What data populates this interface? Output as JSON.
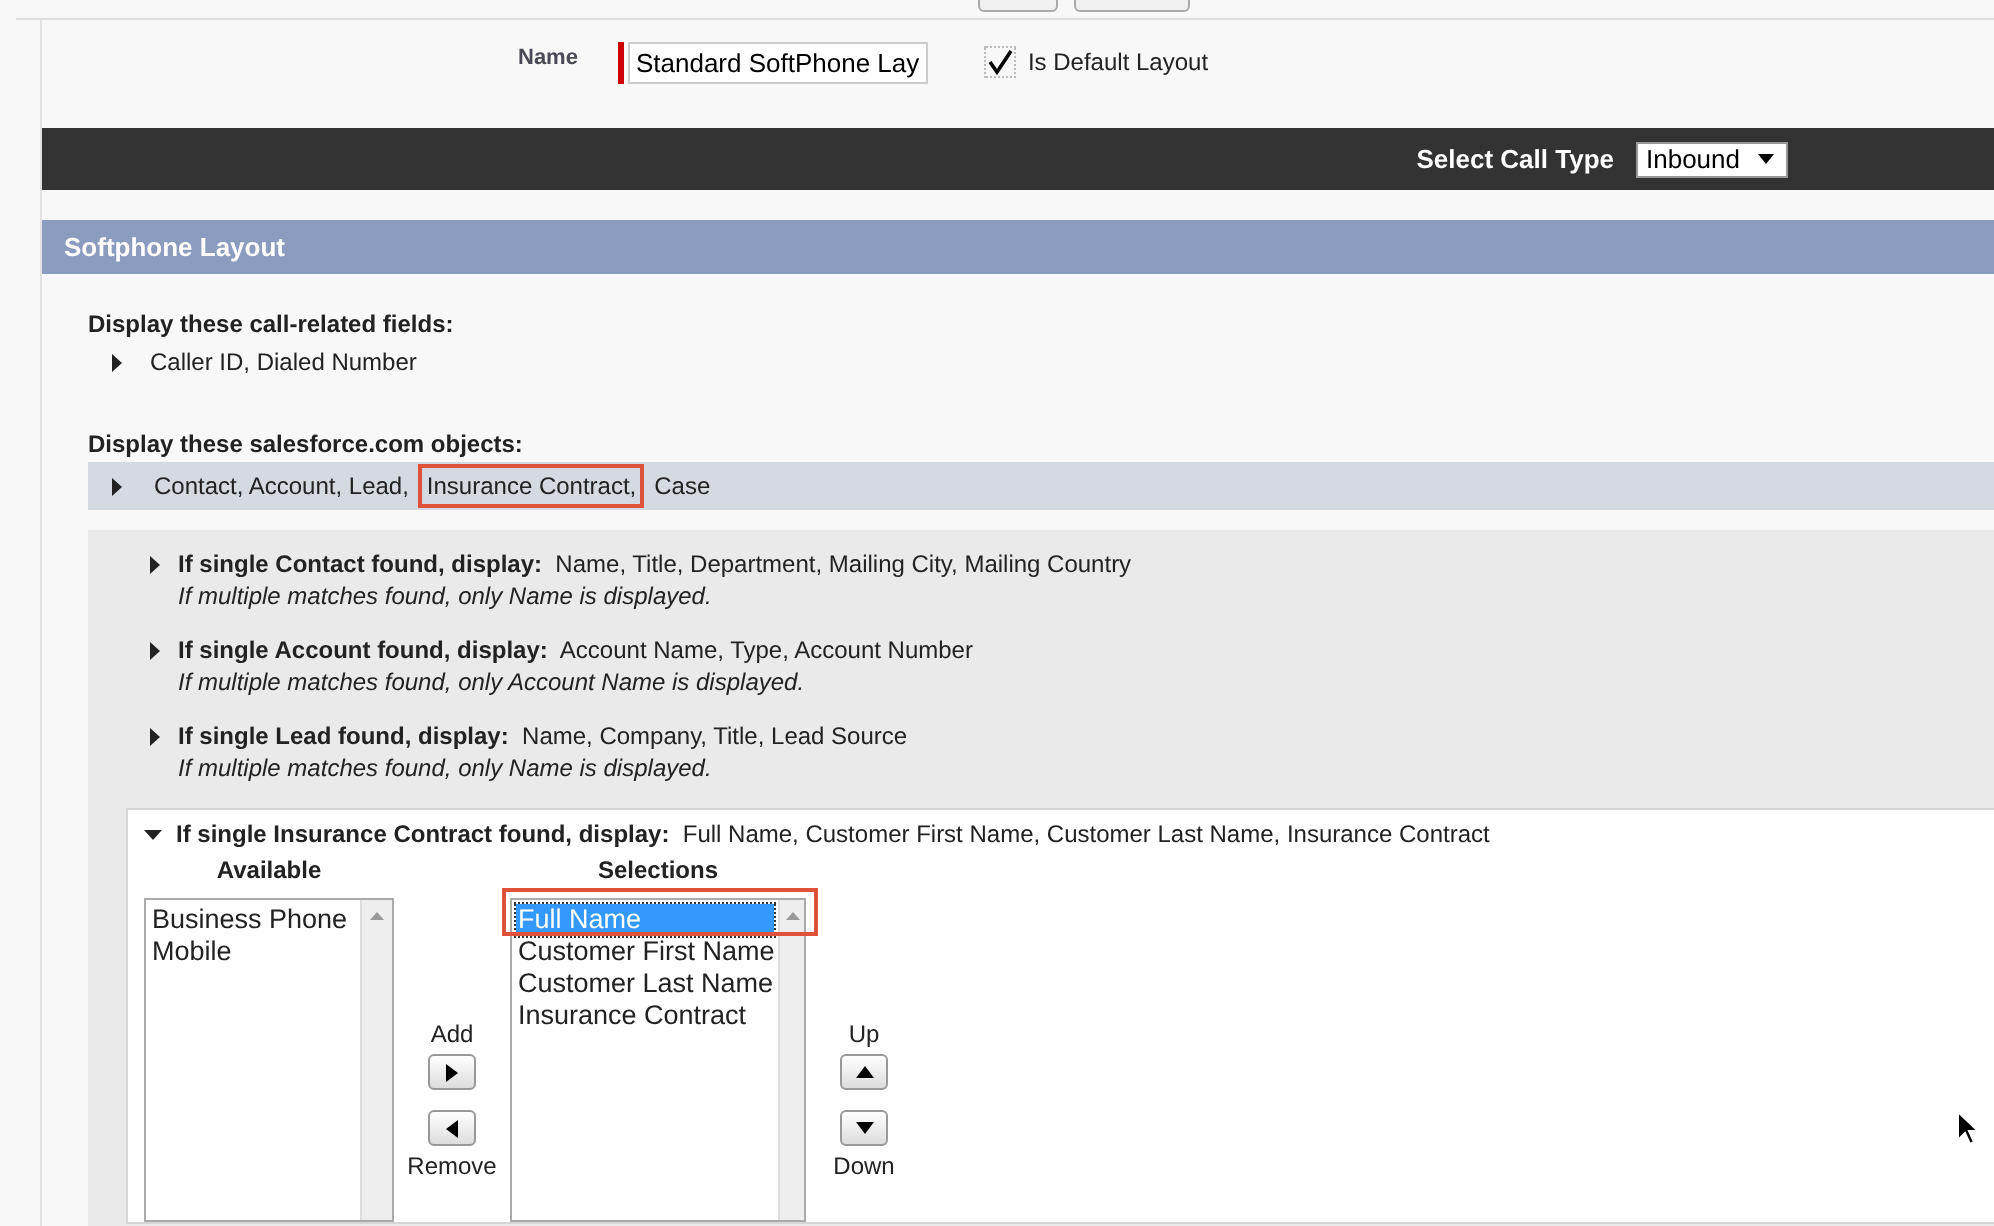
{
  "name_field": {
    "label": "Name",
    "value": "Standard SoftPhone Lay",
    "required": true
  },
  "default_layout": {
    "label": "Is Default Layout",
    "checked": true
  },
  "call_type": {
    "label": "Select Call Type",
    "value": "Inbound"
  },
  "section": {
    "title": "Softphone Layout"
  },
  "call_fields": {
    "heading": "Display these call-related fields:",
    "summary": "Caller ID, Dialed Number",
    "expanded": false
  },
  "objects": {
    "heading": "Display these salesforce.com objects:",
    "expanded": false,
    "summary": [
      {
        "text": "Contact, Account, Lead,",
        "highlighted": false
      },
      {
        "text": "Insurance Contract,",
        "highlighted": true
      },
      {
        "text": "Case",
        "highlighted": false
      }
    ]
  },
  "rules": [
    {
      "label": "If single Contact found, display:",
      "fields": "Name, Title, Department, Mailing City, Mailing Country",
      "note": "If multiple matches found, only Name is displayed.",
      "expanded": false
    },
    {
      "label": "If single Account found, display:",
      "fields": "Account Name, Type, Account Number",
      "note": "If multiple matches found, only Account Name is displayed.",
      "expanded": false
    },
    {
      "label": "If single Lead found, display:",
      "fields": "Name, Company, Title, Lead Source",
      "note": "If multiple matches found, only Name is displayed.",
      "expanded": false
    },
    {
      "label": "If single Insurance Contract found, display:",
      "fields": "Full Name, Customer First Name, Customer Last Name, Insurance Contract",
      "expanded": true
    }
  ],
  "picker": {
    "available_label": "Available",
    "available": [
      "Business Phone",
      "Mobile"
    ],
    "add_label": "Add",
    "remove_label": "Remove",
    "selections_label": "Selections",
    "selections": [
      {
        "text": "Full Name",
        "selected": true,
        "highlighted": true
      },
      {
        "text": "Customer First Name",
        "selected": false,
        "highlighted": false
      },
      {
        "text": "Customer Last Name",
        "selected": false,
        "highlighted": false
      },
      {
        "text": "Insurance Contract",
        "selected": false,
        "highlighted": false
      }
    ],
    "up_label": "Up",
    "down_label": "Down"
  }
}
